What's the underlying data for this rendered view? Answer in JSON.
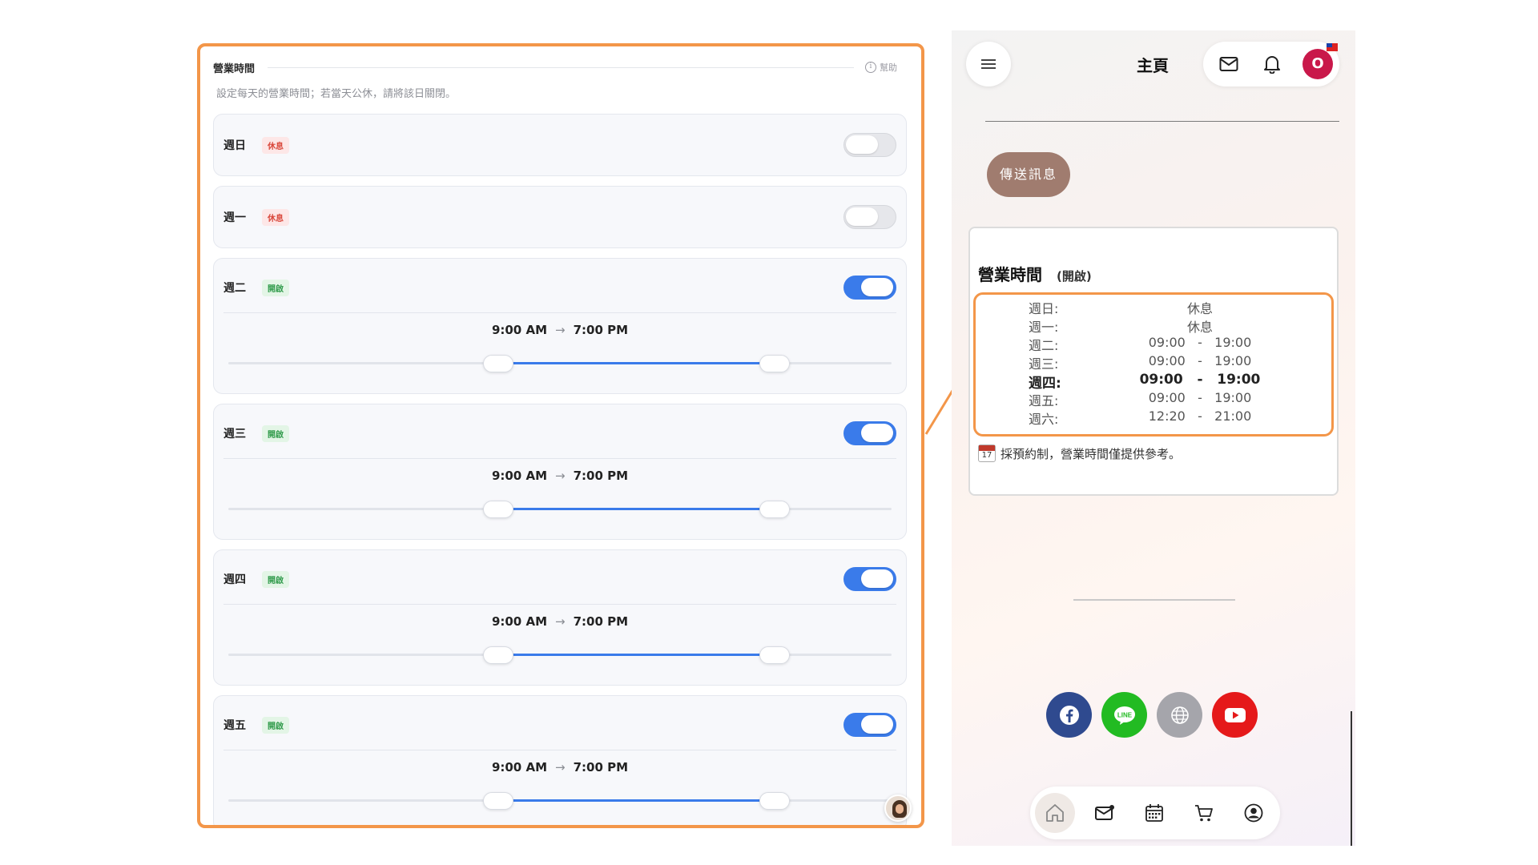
{
  "editor": {
    "title": "營業時間",
    "help_label": "幫助",
    "description": "設定每天的營業時間；若當天公休，請將該日關閉。",
    "days": [
      {
        "name": "週日",
        "status": "休息",
        "open": false
      },
      {
        "name": "週一",
        "status": "休息",
        "open": false
      },
      {
        "name": "週二",
        "status": "開啟",
        "open": true,
        "start": "9:00 AM",
        "end": "7:00 PM"
      },
      {
        "name": "週三",
        "status": "開啟",
        "open": true,
        "start": "9:00 AM",
        "end": "7:00 PM"
      },
      {
        "name": "週四",
        "status": "開啟",
        "open": true,
        "start": "9:00 AM",
        "end": "7:00 PM"
      },
      {
        "name": "週五",
        "status": "開啟",
        "open": true,
        "start": "9:00 AM",
        "end": "7:00 PM"
      }
    ]
  },
  "preview": {
    "title": "主頁",
    "user_initial": "O",
    "send_message": "傳送訊息",
    "hours_title": "營業時間",
    "hours_status": "(開啟)",
    "schedule": [
      {
        "day": "週日:",
        "value": "休息"
      },
      {
        "day": "週一:",
        "value": "休息"
      },
      {
        "day": "週二:",
        "value": "09:00   -   19:00"
      },
      {
        "day": "週三:",
        "value": "09:00   -   19:00"
      },
      {
        "day": "週四:",
        "value": "09:00   -   19:00"
      },
      {
        "day": "週五:",
        "value": "09:00   -   19:00"
      },
      {
        "day": "週六:",
        "value": "12:20   -   21:00"
      }
    ],
    "calendar_day": "17",
    "note": "採預約制，營業時間僅提供參考。",
    "socials": [
      "facebook-icon",
      "line-icon",
      "globe-icon",
      "youtube-icon"
    ],
    "line_label": "LINE",
    "nav": [
      "home-icon",
      "mail-icon",
      "calendar-icon",
      "cart-icon",
      "account-icon"
    ]
  },
  "colors": {
    "highlight": "#f39649",
    "toggle_on": "#3a7bea",
    "closed_badge": "#d9483c",
    "open_badge": "#2f9a4a",
    "send_button": "#a07c6f",
    "avatar": "#c9184a"
  }
}
